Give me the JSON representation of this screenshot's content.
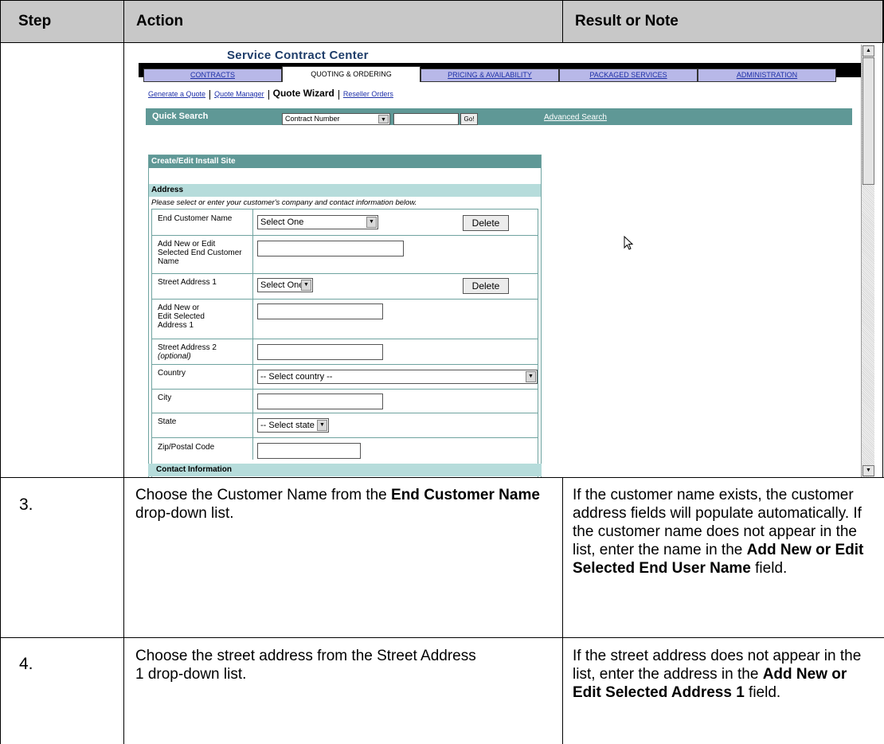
{
  "table": {
    "header": {
      "step": "Step",
      "action": "Action",
      "note": "Result or Note"
    },
    "rows": [
      {
        "step": "3.",
        "action_pre": "Choose the Customer Name from the ",
        "action_bold": "End Customer Name",
        "action_post": " drop-down list.",
        "note_pre": "If the customer name exists, the customer address fields will populate automatically. If the customer name does not appear in the list, enter the name in the ",
        "note_bold": "Add New or Edit Selected End User Name",
        "note_post": " field."
      },
      {
        "step": "4.",
        "action_text": "Choose the street address from the Street Address 1 drop-down list.",
        "note_pre": "If the street address does not appear in the list, enter the address in the ",
        "note_bold": "Add New or Edit Selected Address 1",
        "note_post": " field."
      }
    ]
  },
  "screenshot": {
    "app_title": "Service Contract Center",
    "nav_tabs": [
      "CONTRACTS",
      "QUOTING & ORDERING",
      "PRICING & AVAILABILITY",
      "PACKAGED SERVICES",
      "ADMINISTRATION"
    ],
    "active_tab": "QUOTING & ORDERING",
    "subnav": [
      "Generate a Quote",
      "Quote Manager",
      "Quote Wizard",
      "Reseller Orders"
    ],
    "current_subnav": "Quote Wizard",
    "quick_search": {
      "label": "Quick Search",
      "type_value": "Contract Number",
      "go": "Go!",
      "advanced": "Advanced Search"
    },
    "form": {
      "title": "Create/Edit Install Site",
      "section": "Address",
      "intro": "Please select or enter your customer's company and contact information below.",
      "fields": {
        "end_customer_name": "End Customer Name",
        "add_edit_name": "Add New or Edit Selected End Customer Name",
        "street1": "Street Address 1",
        "add_edit_address": "Add New or Edit Selected Address 1",
        "street2": "Street Address 2",
        "street2_note": "(optional)",
        "country": "Country",
        "city": "City",
        "state": "State",
        "zip": "Zip/Postal Code"
      },
      "select_one": "Select One",
      "select_country": "-- Select country --",
      "select_state": "-- Select state --",
      "delete": "Delete",
      "contact_section": "Contact Information"
    }
  }
}
